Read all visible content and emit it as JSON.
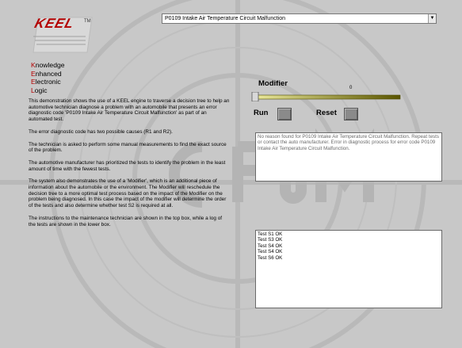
{
  "branding": {
    "logo_text": "KEEL",
    "logo_mark": "TM",
    "acronym": [
      {
        "cap": "K",
        "rest": "nowledge"
      },
      {
        "cap": "E",
        "rest": "nhanced"
      },
      {
        "cap": "E",
        "rest": "lectronic"
      },
      {
        "cap": "L",
        "rest": "ogic"
      }
    ]
  },
  "description": [
    "This demonstration shows the use of a KEEL engine to traverse a decision tree to help an automotive technician diagnose a problem with an automobile that presents an error diagnostic code 'P0109 Intake Air Temperature Circuit Malfunction' as part of an automated test.",
    "The error diagnostic code has two possible causes (R1 and R2).",
    "The technician is asked to perform some manual measurements to find the exact source of the problem.",
    "The automotive manufacturer has prioritized the tests to identify the problem in the least amount of time with the fewest tests.",
    "The system also demonstrates the use of a 'Modifier', which is an additional piece of information about the automobile or the environment. The Modifier will reschedule the decision tree to a more optimal test process based on the impact of the Modifier on the problem being diagnosed. In this case the impact of the modifier will determine the order of the tests and also determine whether test S2 is required at all.",
    "The instructions to the maintenance technician are shown in the top box, while a log of the tests are shown in the lower box."
  ],
  "dropdown": {
    "selected": "P0109 Intake Air Temperature Circuit Malfunction"
  },
  "modifier": {
    "label": "Modifier",
    "value_text": "0",
    "value": 0,
    "min": 0,
    "max": 100
  },
  "buttons": {
    "run_label": "Run",
    "reset_label": "Reset"
  },
  "message_box": {
    "text": "No reason found for P0109 Intake Air Temperature Circuit Malfunction.  Repeat tests or contact the auto manufacturer.  Error in diagnostic process for error code P0109 Intake Air Temperature Circuit Malfunction."
  },
  "log_box": {
    "lines": [
      "Test S1 OK",
      "Test S3 OK",
      "Test S4 OK",
      "Test S4 OK",
      "Test S6 OK"
    ]
  },
  "colors": {
    "background": "#c8c8c8",
    "brand_red": "#b30000",
    "slider_track_light": "#ecea9c",
    "slider_track_dark": "#5a5500"
  }
}
